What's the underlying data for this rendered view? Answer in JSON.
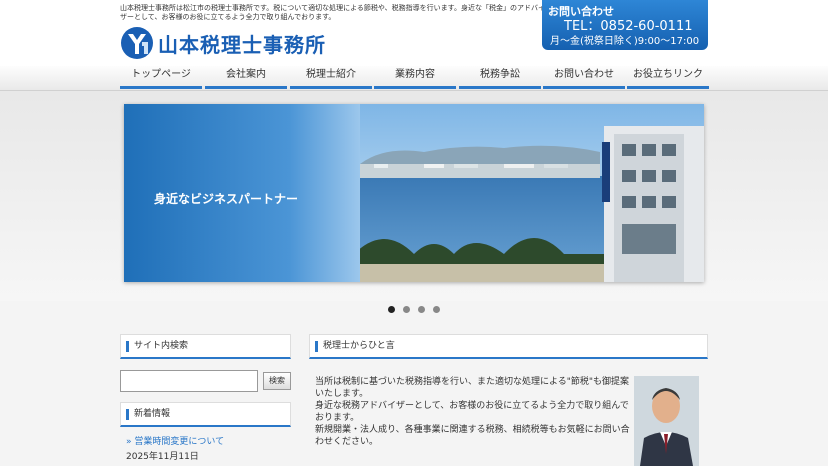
{
  "header": {
    "intro": "山本税理士事務所は松江市の税理士事務所です。税について適切な処理による節税や、税務指導を行います。身近な「税金」のアドバイザーとして、お客様のお役に立てるよう全力で取り組んでおります。",
    "logo_text": "山本税理士事務所",
    "contact_title": "お問い合わせ",
    "contact_tel": "TEL：0852-60-0111",
    "contact_hours": "月～金(祝祭日除く)9:00～17:00"
  },
  "nav": {
    "items": [
      {
        "label": "トップページ"
      },
      {
        "label": "会社案内"
      },
      {
        "label": "税理士紹介"
      },
      {
        "label": "業務内容"
      },
      {
        "label": "税務争訟"
      },
      {
        "label": "お問い合わせ"
      },
      {
        "label": "お役立ちリンク"
      }
    ]
  },
  "slider": {
    "caption": "身近なビジネスパートナー",
    "dot_count": 4,
    "active_index": 0
  },
  "sidebar": {
    "search_heading": "サイト内検索",
    "search_button": "検索",
    "search_value": "",
    "news_heading": "新着情報",
    "news": [
      {
        "title": "営業時間変更について",
        "date": "2025年11月11日"
      }
    ]
  },
  "main": {
    "heading": "税理士からひと言",
    "paragraph1": "当所は税制に基づいた税務指導を行い、また適切な処理による\"節税\"も御提案いたします。",
    "paragraph2": "身近な税務アドバイザーとして、お客様のお役に立てるよう全力で取り組んでおります。",
    "paragraph3": "新規開業・法人成り、各種事業に関連する税務、相続税等もお気軽にお問い合わせください。"
  },
  "colors": {
    "accent": "#2a77c8",
    "brand": "#1a5fb4"
  }
}
